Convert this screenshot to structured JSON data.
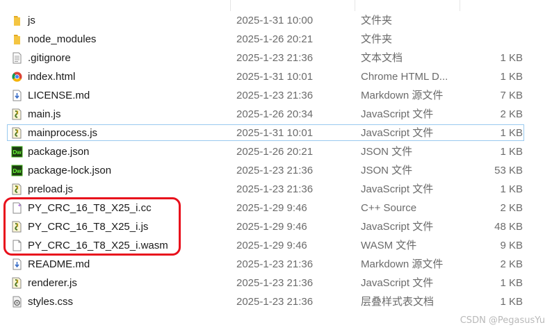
{
  "file_list": {
    "rows": [
      {
        "name": "js",
        "date": "2025-1-31 10:00",
        "type": "文件夹",
        "size": "",
        "icon": "folder-icon"
      },
      {
        "name": "node_modules",
        "date": "2025-1-26 20:21",
        "type": "文件夹",
        "size": "",
        "icon": "folder-icon"
      },
      {
        "name": ".gitignore",
        "date": "2025-1-23 21:36",
        "type": "文本文档",
        "size": "1 KB",
        "icon": "text-file-icon"
      },
      {
        "name": "index.html",
        "date": "2025-1-31 10:01",
        "type": "Chrome HTML D...",
        "size": "1 KB",
        "icon": "chrome-icon"
      },
      {
        "name": "LICENSE.md",
        "date": "2025-1-23 21:36",
        "type": "Markdown 源文件",
        "size": "7 KB",
        "icon": "markdown-file-icon"
      },
      {
        "name": "main.js",
        "date": "2025-1-26 20:34",
        "type": "JavaScript 文件",
        "size": "2 KB",
        "icon": "js-file-icon"
      },
      {
        "name": "mainprocess.js",
        "date": "2025-1-31 10:01",
        "type": "JavaScript 文件",
        "size": "1 KB",
        "icon": "js-file-icon",
        "selected": true
      },
      {
        "name": "package.json",
        "date": "2025-1-26 20:21",
        "type": "JSON 文件",
        "size": "1 KB",
        "icon": "dreamweaver-icon"
      },
      {
        "name": "package-lock.json",
        "date": "2025-1-23 21:36",
        "type": "JSON 文件",
        "size": "53 KB",
        "icon": "dreamweaver-icon"
      },
      {
        "name": "preload.js",
        "date": "2025-1-23 21:36",
        "type": "JavaScript 文件",
        "size": "1 KB",
        "icon": "js-file-icon"
      },
      {
        "name": "PY_CRC_16_T8_X25_i.cc",
        "date": "2025-1-29 9:46",
        "type": "C++ Source",
        "size": "2 KB",
        "icon": "cpp-file-icon"
      },
      {
        "name": "PY_CRC_16_T8_X25_i.js",
        "date": "2025-1-29 9:46",
        "type": "JavaScript 文件",
        "size": "48 KB",
        "icon": "js-file-icon"
      },
      {
        "name": "PY_CRC_16_T8_X25_i.wasm",
        "date": "2025-1-29 9:46",
        "type": "WASM 文件",
        "size": "9 KB",
        "icon": "blank-file-icon"
      },
      {
        "name": "README.md",
        "date": "2025-1-23 21:36",
        "type": "Markdown 源文件",
        "size": "2 KB",
        "icon": "markdown-file-icon"
      },
      {
        "name": "renderer.js",
        "date": "2025-1-23 21:36",
        "type": "JavaScript 文件",
        "size": "1 KB",
        "icon": "js-file-icon"
      },
      {
        "name": "styles.css",
        "date": "2025-1-23 21:36",
        "type": "层叠样式表文档",
        "size": "1 KB",
        "icon": "css-file-icon"
      }
    ]
  },
  "colors": {
    "highlight_border": "#e8101c",
    "selection_border": "#99c9ef",
    "folder": "#f4c542"
  },
  "watermark": "CSDN @PegasusYu"
}
